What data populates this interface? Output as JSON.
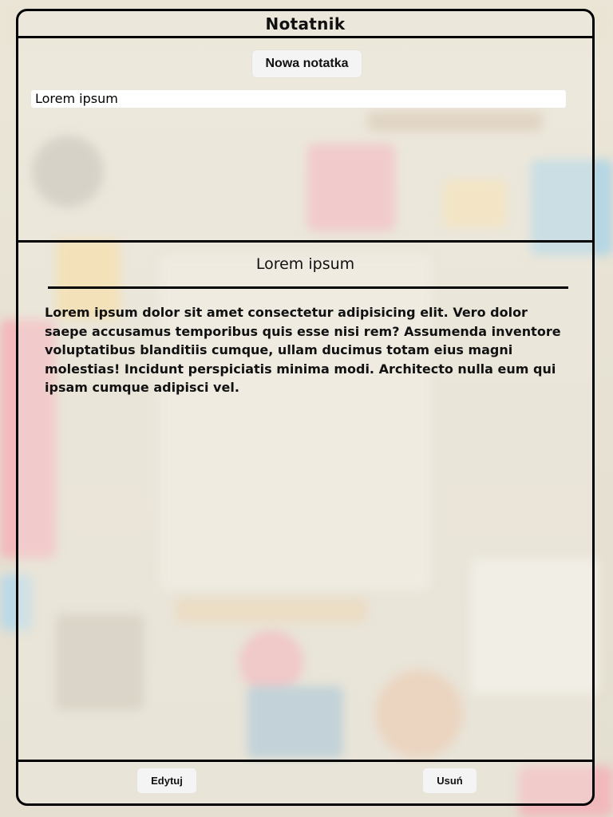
{
  "app": {
    "title": "Notatnik"
  },
  "toolbar": {
    "new_note_label": "Nowa notatka"
  },
  "notes_list": [
    {
      "title": "Lorem ipsum"
    }
  ],
  "selected_note": {
    "title": "Lorem ipsum",
    "body": "Lorem ipsum dolor sit amet consectetur adipisicing elit. Vero dolor saepe accusamus temporibus quis esse nisi rem? Assumenda inventore voluptatibus blanditiis cumque, ullam ducimus totam eius magni molestias! Incidunt perspiciatis minima modi. Architecto nulla eum qui ipsam cumque adipisci vel."
  },
  "footer": {
    "edit_label": "Edytuj",
    "delete_label": "Usuń"
  },
  "colors": {
    "border": "#000000",
    "button_bg": "#f4f4f4",
    "list_item_bg": "#ffffff"
  }
}
